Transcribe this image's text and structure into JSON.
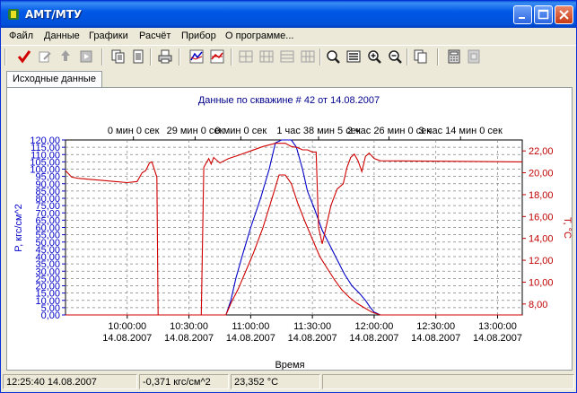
{
  "window": {
    "title": "АМТ/МТУ"
  },
  "menu": [
    "Файл",
    "Данные",
    "Графики",
    "Расчёт",
    "Прибор",
    "О программе..."
  ],
  "toolbar_icons": [
    "check-icon",
    "edit-icon",
    "recycle-icon",
    "play-icon",
    "copy-icon",
    "page-icon",
    "print-icon",
    "chart-blue-icon",
    "chart-red-icon",
    "grid1-icon",
    "grid2-icon",
    "grid3-icon",
    "grid4-icon",
    "zoom-find-icon",
    "list-icon",
    "zoom-in-icon",
    "zoom-out-icon",
    "copy2-icon",
    "calculator-icon",
    "export-icon"
  ],
  "tab": {
    "label": "Исходные данные"
  },
  "chart_data": {
    "type": "line",
    "title": "Данные по скважине # 42 от 14.08.2007",
    "top_axis_labels": [
      "0 мин 0 сек",
      "29 мин 0 сек",
      "0 мин 0 сек",
      "1 час 38 мин 5 сек",
      "2 час 26 мин 0 сек",
      "3 час 14 мин 0 сек"
    ],
    "x_ticks": [
      {
        "time": "10:00:00",
        "date": "14.08.2007"
      },
      {
        "time": "10:30:00",
        "date": "14.08.2007"
      },
      {
        "time": "11:00:00",
        "date": "14.08.2007"
      },
      {
        "time": "11:30:00",
        "date": "14.08.2007"
      },
      {
        "time": "12:00:00",
        "date": "14.08.2007"
      },
      {
        "time": "12:30:00",
        "date": "14.08.2007"
      },
      {
        "time": "13:00:00",
        "date": "14.08.2007"
      }
    ],
    "xlabel": "Время",
    "ylabel_left": "P, кгс/см^2",
    "ylabel_right": "T, °C",
    "y_left_ticks": [
      "0,00",
      "5,00",
      "10,00",
      "15,00",
      "20,00",
      "25,00",
      "30,00",
      "35,00",
      "40,00",
      "45,00",
      "50,00",
      "55,00",
      "60,00",
      "65,00",
      "70,00",
      "75,00",
      "80,00",
      "85,00",
      "90,00",
      "95,00",
      "100,00",
      "105,00",
      "110,00",
      "115,00",
      "120,00"
    ],
    "y_right_ticks": [
      "8,00",
      "10,00",
      "12,00",
      "14,00",
      "16,00",
      "18,00",
      "20,00",
      "22,00"
    ],
    "ylim_left": [
      0,
      120
    ],
    "ylim_right": [
      7,
      23
    ],
    "colors": {
      "pressure": "#0000c8",
      "temperature": "#d00000",
      "axis_left": "#0000c8",
      "axis_right": "#c00000",
      "grid": "#808080"
    },
    "series": [
      {
        "axis": "left",
        "color": "#0000c8",
        "points": [
          [
            9.5,
            0
          ],
          [
            10.8,
            0
          ],
          [
            10.84,
            10
          ],
          [
            10.88,
            25
          ],
          [
            10.93,
            40
          ],
          [
            11.0,
            60
          ],
          [
            11.08,
            80
          ],
          [
            11.15,
            100
          ],
          [
            11.2,
            118
          ],
          [
            11.25,
            121
          ],
          [
            11.33,
            121
          ],
          [
            11.37,
            115
          ],
          [
            11.42,
            100
          ],
          [
            11.46,
            85
          ],
          [
            11.52,
            72
          ],
          [
            11.58,
            58
          ],
          [
            11.64,
            48
          ],
          [
            11.7,
            38
          ],
          [
            11.76,
            28
          ],
          [
            11.82,
            20
          ],
          [
            11.88,
            15
          ],
          [
            11.93,
            10
          ],
          [
            11.97,
            5
          ],
          [
            12.0,
            2
          ],
          [
            12.05,
            0
          ],
          [
            13.2,
            0
          ]
        ]
      },
      {
        "axis": "right",
        "color": "#d00000",
        "points": [
          [
            9.5,
            20.2
          ],
          [
            9.55,
            19.6
          ],
          [
            9.6,
            19.5
          ],
          [
            9.7,
            19.4
          ],
          [
            9.8,
            19.3
          ],
          [
            9.9,
            19.2
          ],
          [
            10.0,
            19.1
          ],
          [
            10.08,
            19.2
          ],
          [
            10.12,
            20.0
          ],
          [
            10.15,
            20.2
          ],
          [
            10.18,
            20.9
          ],
          [
            10.2,
            21.0
          ],
          [
            10.22,
            20.3
          ],
          [
            10.24,
            19.6
          ],
          [
            10.25,
            7.0
          ],
          [
            10.6,
            7.0
          ],
          [
            10.62,
            20.5
          ],
          [
            10.66,
            21.3
          ],
          [
            10.68,
            20.8
          ],
          [
            10.7,
            21.4
          ],
          [
            10.75,
            20.9
          ],
          [
            10.82,
            21.3
          ],
          [
            10.9,
            21.6
          ],
          [
            11.0,
            22.0
          ],
          [
            11.1,
            22.4
          ],
          [
            11.2,
            22.7
          ],
          [
            11.28,
            22.7
          ],
          [
            11.33,
            22.4
          ],
          [
            11.38,
            22.3
          ],
          [
            11.42,
            22.1
          ],
          [
            11.46,
            22.1
          ],
          [
            11.5,
            21.9
          ],
          [
            11.53,
            21.9
          ],
          [
            11.55,
            15.0
          ],
          [
            11.58,
            13.5
          ],
          [
            11.6,
            14.5
          ],
          [
            11.65,
            17.0
          ],
          [
            11.7,
            18.5
          ],
          [
            11.75,
            19.0
          ],
          [
            11.78,
            20.5
          ],
          [
            11.81,
            21.4
          ],
          [
            11.84,
            21.7
          ],
          [
            11.87,
            21.1
          ],
          [
            11.9,
            20.1
          ],
          [
            11.93,
            21.5
          ],
          [
            11.96,
            21.8
          ],
          [
            12.0,
            21.3
          ],
          [
            12.05,
            21.1
          ],
          [
            13.2,
            21.0
          ]
        ]
      },
      {
        "axis": "left",
        "color": "#d00000",
        "points": [
          [
            9.5,
            0
          ],
          [
            10.8,
            0
          ],
          [
            10.84,
            8
          ],
          [
            10.9,
            18
          ],
          [
            10.95,
            28
          ],
          [
            11.02,
            42
          ],
          [
            11.1,
            60
          ],
          [
            11.18,
            82
          ],
          [
            11.23,
            96
          ],
          [
            11.28,
            96
          ],
          [
            11.33,
            90
          ],
          [
            11.38,
            77
          ],
          [
            11.44,
            64
          ],
          [
            11.5,
            52
          ],
          [
            11.56,
            40
          ],
          [
            11.62,
            32
          ],
          [
            11.68,
            24
          ],
          [
            11.74,
            17
          ],
          [
            11.8,
            12
          ],
          [
            11.86,
            8
          ],
          [
            11.92,
            5
          ],
          [
            11.98,
            2
          ],
          [
            12.05,
            0
          ],
          [
            13.2,
            0
          ]
        ]
      }
    ]
  },
  "status": {
    "time": "12:25:40 14.08.2007",
    "pressure": "-0,371 кгс/см^2",
    "temperature": "23,352 °C"
  }
}
